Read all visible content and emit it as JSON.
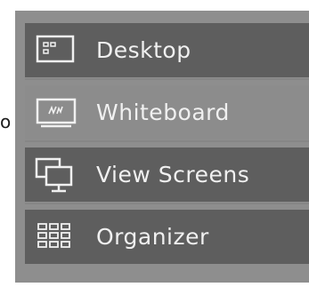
{
  "edge_glyph": "o",
  "menu": {
    "items": [
      {
        "label": "Desktop",
        "icon": "desktop-window-icon",
        "active": false
      },
      {
        "label": "Whiteboard",
        "icon": "whiteboard-icon",
        "active": true
      },
      {
        "label": "View Screens",
        "icon": "view-screens-icon",
        "active": false
      },
      {
        "label": "Organizer",
        "icon": "organizer-grid-icon",
        "active": false
      }
    ]
  },
  "colors": {
    "panel_background": "#8e8e8e",
    "item_background": "#5e5e5e",
    "active_item_background": "#8c8c8c",
    "text": "#f0f0f0"
  }
}
